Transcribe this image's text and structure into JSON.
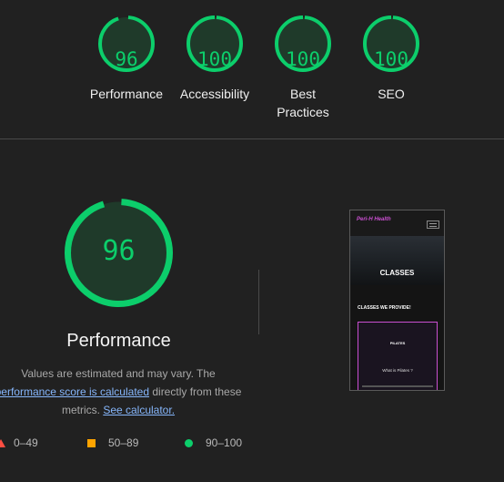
{
  "scores": [
    {
      "score": "96",
      "label": "Performance",
      "fraction": 0.96
    },
    {
      "score": "100",
      "label": "Accessibility",
      "fraction": 1.0
    },
    {
      "score": "100",
      "label": "Best Practices",
      "fraction": 1.0
    },
    {
      "score": "100",
      "label": "SEO",
      "fraction": 1.0
    }
  ],
  "performance": {
    "score": "96",
    "fraction": 0.96,
    "title": "Performance",
    "desc_1": "Values are estimated and may vary. The",
    "desc_link_1": "performance score is calculated",
    "desc_2": " directly from these metrics.",
    "desc_link_2": "See calculator."
  },
  "legend": {
    "fail": "0–49",
    "average": "50–89",
    "pass": "90–100"
  },
  "colors": {
    "pass": "#0cce6b",
    "average": "#ffa400",
    "fail": "#ff4e42",
    "link": "#86b6fb",
    "background": "#212121"
  },
  "screenshot": {
    "logo": "Peri-H Health",
    "hero_title": "CLASSES",
    "subheading": "CLASSES WE PROVIDE!",
    "card_title": "PILATES",
    "card_question": "What is Pilates ?"
  }
}
